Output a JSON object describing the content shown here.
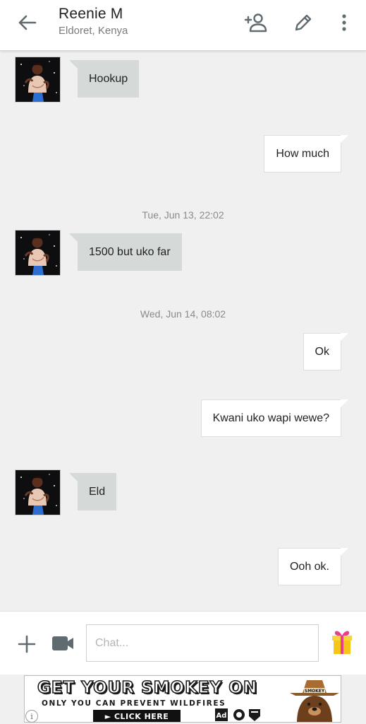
{
  "header": {
    "name": "Reenie M",
    "location": "Eldoret, Kenya",
    "icons": {
      "back": "arrow-left-icon",
      "add_person": "add-person-icon",
      "edit": "pencil-icon",
      "more": "more-vertical-icon"
    }
  },
  "messages": [
    {
      "dir": "in",
      "text": "Hookup"
    },
    {
      "dir": "out",
      "text": "How much"
    },
    {
      "type": "timestamp",
      "text": "Tue, Jun 13, 22:02"
    },
    {
      "dir": "in",
      "text": "1500 but uko far"
    },
    {
      "type": "timestamp",
      "text": "Wed, Jun 14, 08:02"
    },
    {
      "dir": "out",
      "text": "Ok"
    },
    {
      "dir": "out",
      "text": "Kwani uko wapi wewe?"
    },
    {
      "dir": "in",
      "text": "Eld"
    },
    {
      "dir": "out",
      "text": "Ooh ok."
    }
  ],
  "composer": {
    "placeholder": "Chat...",
    "value": "",
    "icons": {
      "add": "plus-icon",
      "video": "video-camera-icon",
      "gift": "gift-icon"
    }
  },
  "ad": {
    "headline": "GET YOUR SMOKEY ON",
    "subline": "ONLY YOU CAN PREVENT WILDFIRES",
    "cta": "► CLICK HERE",
    "hat_text": "SMOKEY",
    "logo_mark": "Ad",
    "info_icon": "info-icon",
    "info_glyph": "i"
  },
  "colors": {
    "background": "#f0f0f0",
    "incoming_bubble": "#d5d9d8",
    "outgoing_bubble": "#ffffff",
    "icon_gray": "#5f6b6e"
  }
}
